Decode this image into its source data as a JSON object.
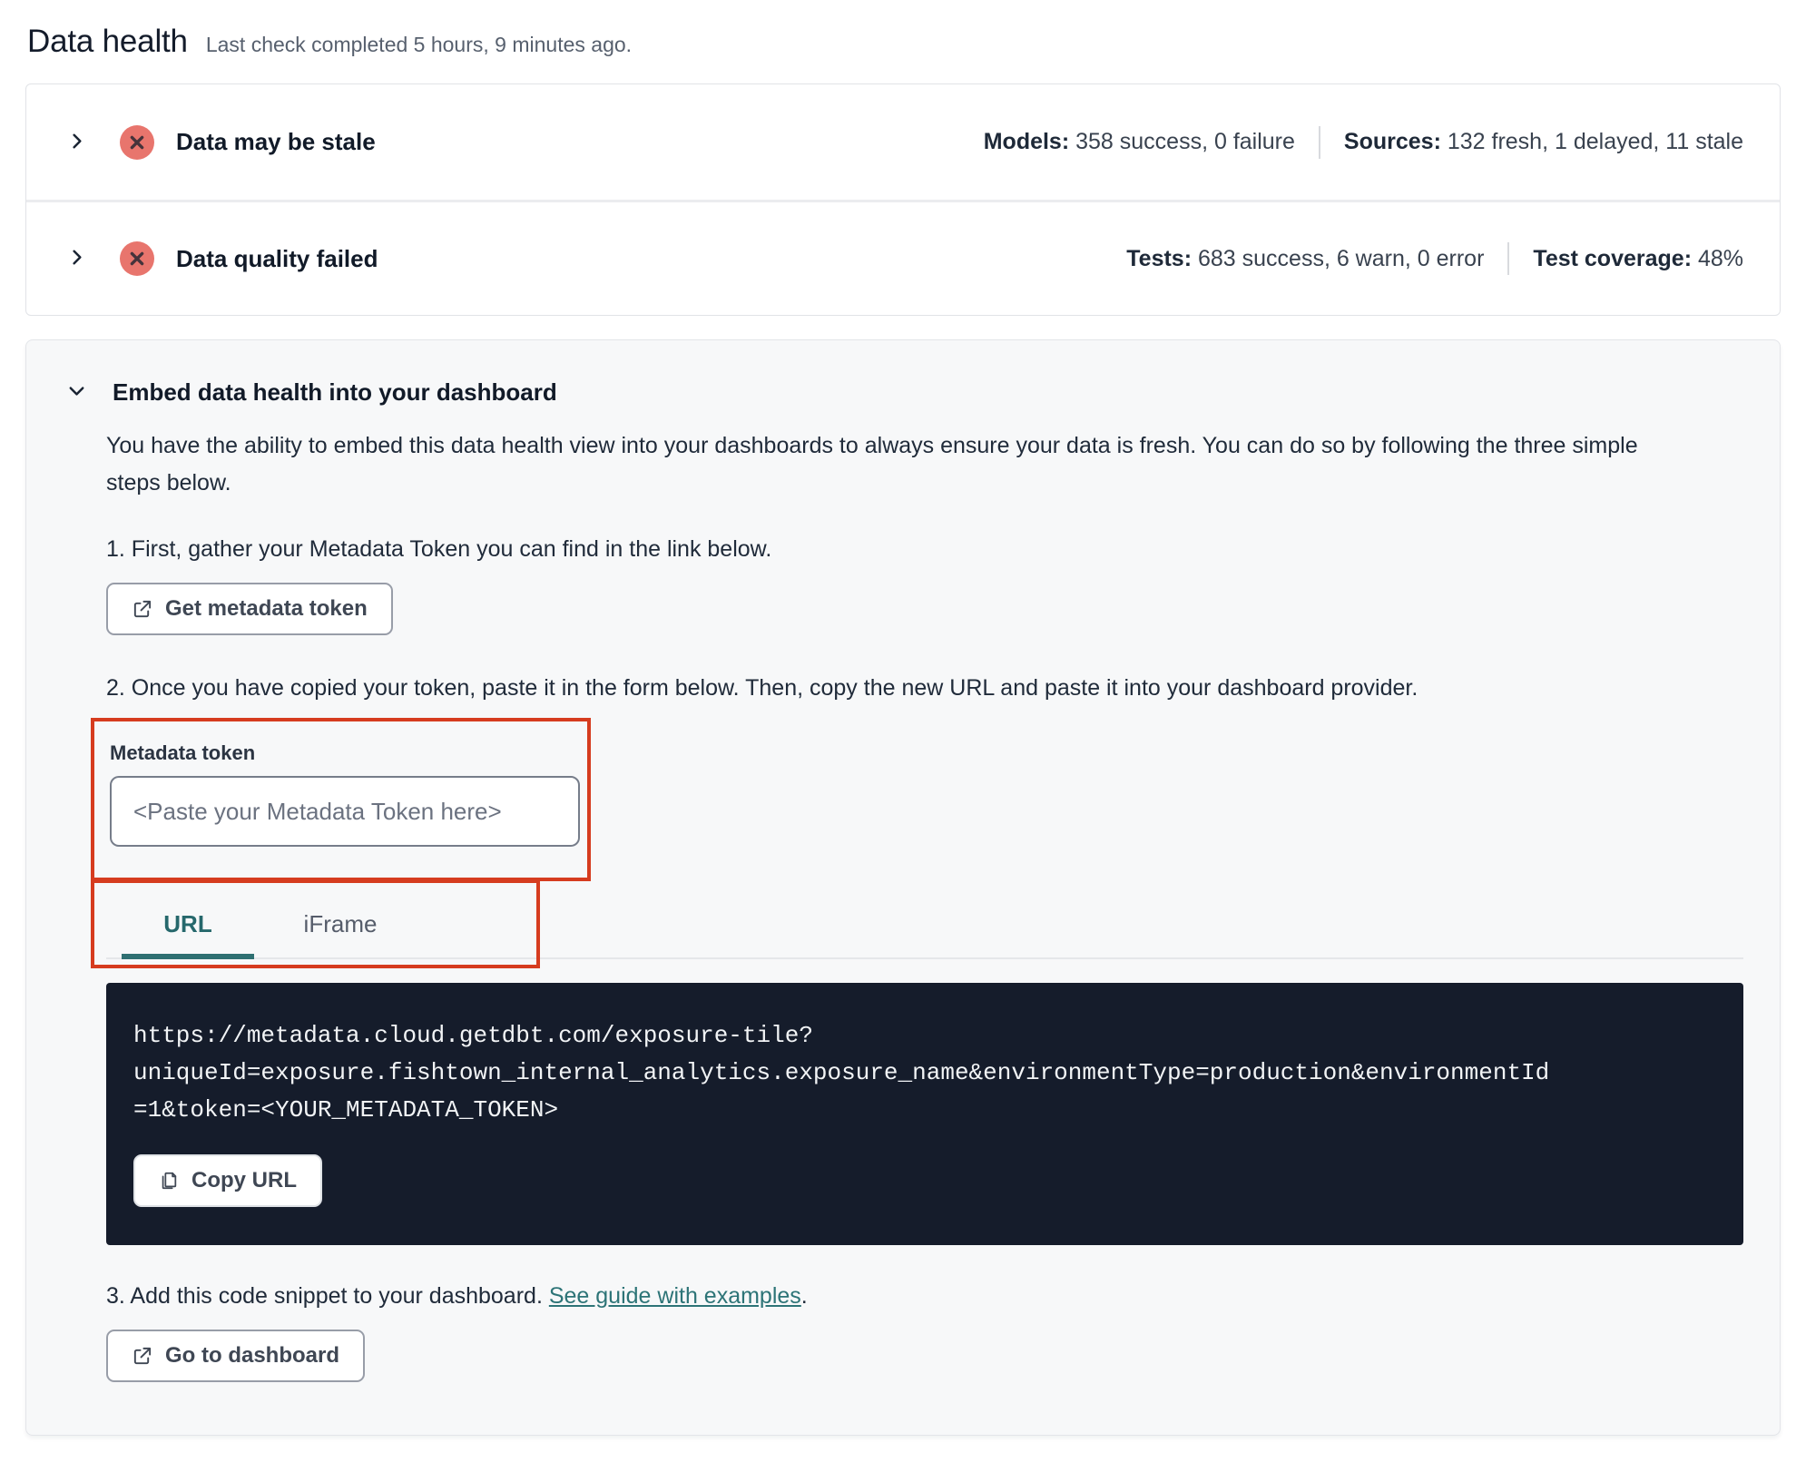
{
  "page": {
    "title": "Data health",
    "subtitle": "Last check completed 5 hours, 9 minutes ago."
  },
  "status_rows": [
    {
      "label": "Data may be stale",
      "stats": [
        {
          "name": "Models:",
          "value": " 358 success, 0 failure"
        },
        {
          "name": "Sources:",
          "value": " 132 fresh, 1 delayed, 11 stale"
        }
      ]
    },
    {
      "label": "Data quality failed",
      "stats": [
        {
          "name": "Tests:",
          "value": " 683 success, 6 warn, 0 error"
        },
        {
          "name": "Test coverage:",
          "value": " 48%"
        }
      ]
    }
  ],
  "embed": {
    "title": "Embed data health into your dashboard",
    "description": "You have the ability to embed this data health view into your dashboards to always ensure your data is fresh. You can do so by following the three simple steps below.",
    "steps": {
      "step1": "1. First, gather your Metadata Token you can find in the link below.",
      "step2": "2. Once you have copied your token, paste it in the form below. Then, copy the new URL and paste it into your dashboard provider.",
      "step3_prefix": "3. Add this code snippet to your dashboard. ",
      "step3_link": "See guide with examples",
      "step3_suffix": "."
    },
    "buttons": {
      "get_token": "Get metadata token",
      "copy_url": "Copy URL",
      "go_dashboard": "Go to dashboard"
    },
    "token_field": {
      "label": "Metadata token",
      "placeholder": "<Paste your Metadata Token here>",
      "value": ""
    },
    "tabs": [
      {
        "label": "URL",
        "active": true
      },
      {
        "label": "iFrame",
        "active": false
      }
    ],
    "code_url": "https://metadata.cloud.getdbt.com/exposure-tile?uniqueId=exposure.fishtown_internal_analytics.exposure_name&environmentType=production&environmentId=1&token=<YOUR_METADATA_TOKEN>",
    "code_lines": [
      "https://metadata.cloud.getdbt.com/exposure-tile?",
      "uniqueId=exposure.fishtown_internal_analytics.exposure_name&environmentType=production&environmentId",
      "=1&token=<YOUR_METADATA_TOKEN>"
    ]
  },
  "icons": {
    "status_error": "x-circle",
    "expand": "chevron-right",
    "collapse": "chevron-down",
    "external": "external-link",
    "copy": "copy-pages"
  },
  "colors": {
    "accent_teal": "#2A7074",
    "annotation_red": "#D63C1F",
    "error_icon_fill": "#E8756D",
    "code_background": "#151C2B",
    "card_background": "#F7F8F9"
  }
}
